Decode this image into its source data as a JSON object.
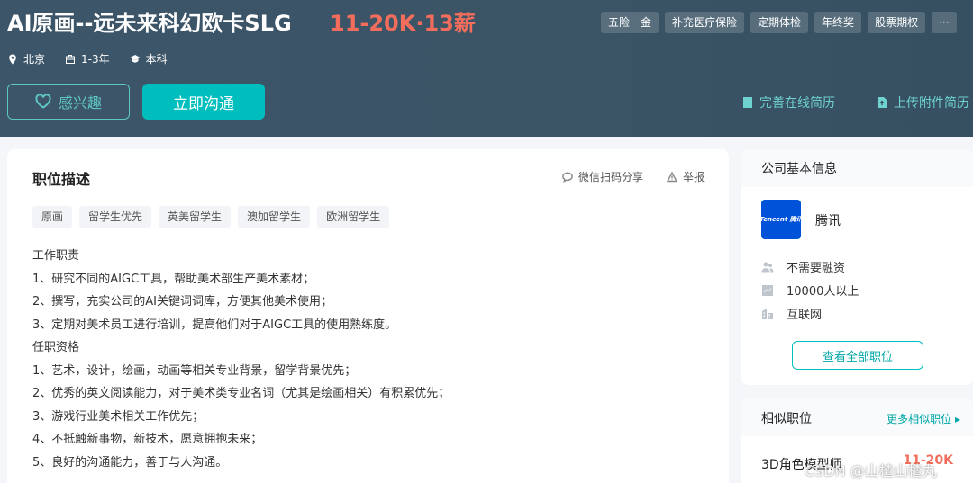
{
  "header": {
    "job_title": "AI原画--远未来科幻欧卡SLG",
    "salary": "11-20K·13薪",
    "benefits": [
      "五险一金",
      "补充医疗保险",
      "定期体检",
      "年终奖",
      "股票期权",
      "···"
    ],
    "meta": {
      "location": "北京",
      "experience": "1-3年",
      "education": "本科"
    },
    "interest_label": "感兴趣",
    "chat_label": "立即沟通",
    "resume_online_label": "完善在线简历",
    "resume_upload_label": "上传附件简历"
  },
  "job": {
    "section_title": "职位描述",
    "share_label": "微信扫码分享",
    "report_label": "举报",
    "tags": [
      "原画",
      "留学生优先",
      "英美留学生",
      "澳加留学生",
      "欧洲留学生"
    ],
    "description": [
      "工作职责",
      "1、研究不同的AIGC工具，帮助美术部生产美术素材；",
      "2、撰写，充实公司的AI关键词词库，方便其他美术使用；",
      "3、定期对美术员工进行培训，提高他们对于AIGC工具的使用熟练度。",
      "任职资格",
      "1、艺术，设计，绘画，动画等相关专业背景，留学背景优先；",
      "2、优秀的英文阅读能力，对于美术类专业名词（尤其是绘画相关）有积累优先；",
      "3、游戏行业美术相关工作优先；",
      "4、不抵触新事物，新技术，愿意拥抱未来；",
      "5、良好的沟通能力，善于与人沟通。"
    ]
  },
  "company": {
    "section_title": "公司基本信息",
    "logo_text": "Tencent 腾讯",
    "name": "腾讯",
    "funding": "不需要融资",
    "size": "10000人以上",
    "industry": "互联网",
    "all_jobs_label": "查看全部职位"
  },
  "similar": {
    "title": "相似职位",
    "more_label": "更多相似职位 ▸",
    "job_title": "3D角色模型师",
    "job_salary": "11-20K"
  },
  "watermark": "CSDN @山楂山楂丸",
  "colors": {
    "accent": "#00bebd",
    "salary": "#f26d5b",
    "header_bg": "#3d5568"
  }
}
